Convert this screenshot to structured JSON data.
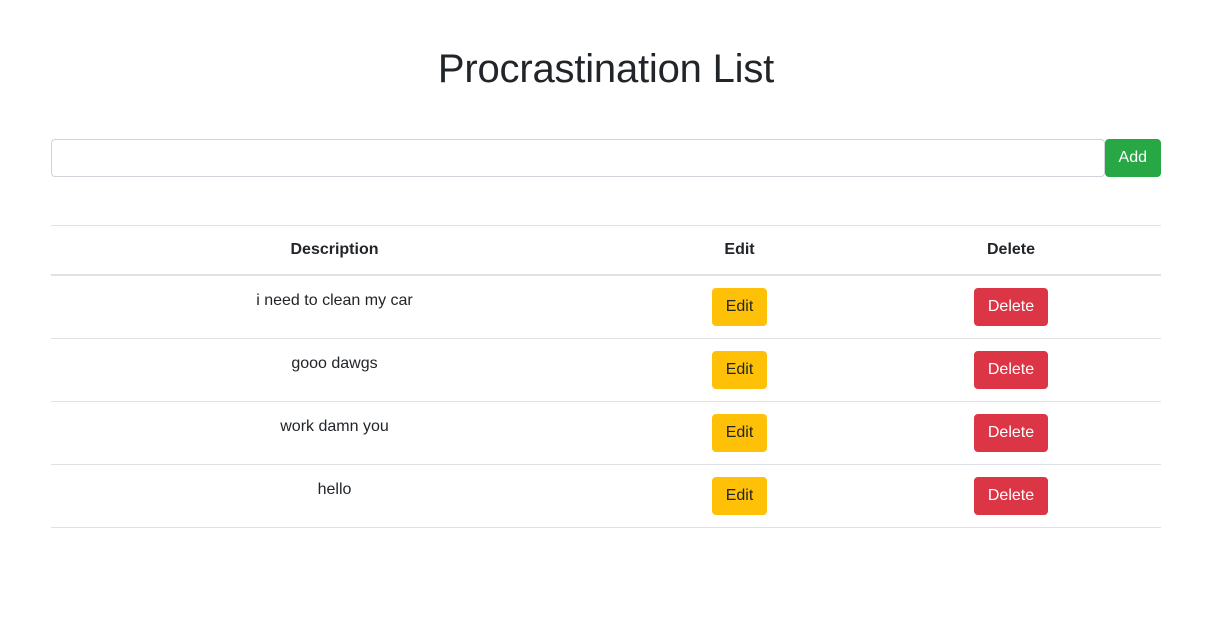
{
  "page": {
    "title": "Procrastination List"
  },
  "add_form": {
    "input_value": "",
    "input_placeholder": "",
    "add_label": "Add"
  },
  "table": {
    "headers": [
      "Description",
      "Edit",
      "Delete"
    ],
    "rows": [
      {
        "description": "i need to clean my car",
        "edit_label": "Edit",
        "delete_label": "Delete"
      },
      {
        "description": "gooo dawgs",
        "edit_label": "Edit",
        "delete_label": "Delete"
      },
      {
        "description": "work damn you",
        "edit_label": "Edit",
        "delete_label": "Delete"
      },
      {
        "description": "hello",
        "edit_label": "Edit",
        "delete_label": "Delete"
      }
    ]
  },
  "colors": {
    "add": "#28a745",
    "edit": "#ffc107",
    "delete": "#dc3545"
  }
}
